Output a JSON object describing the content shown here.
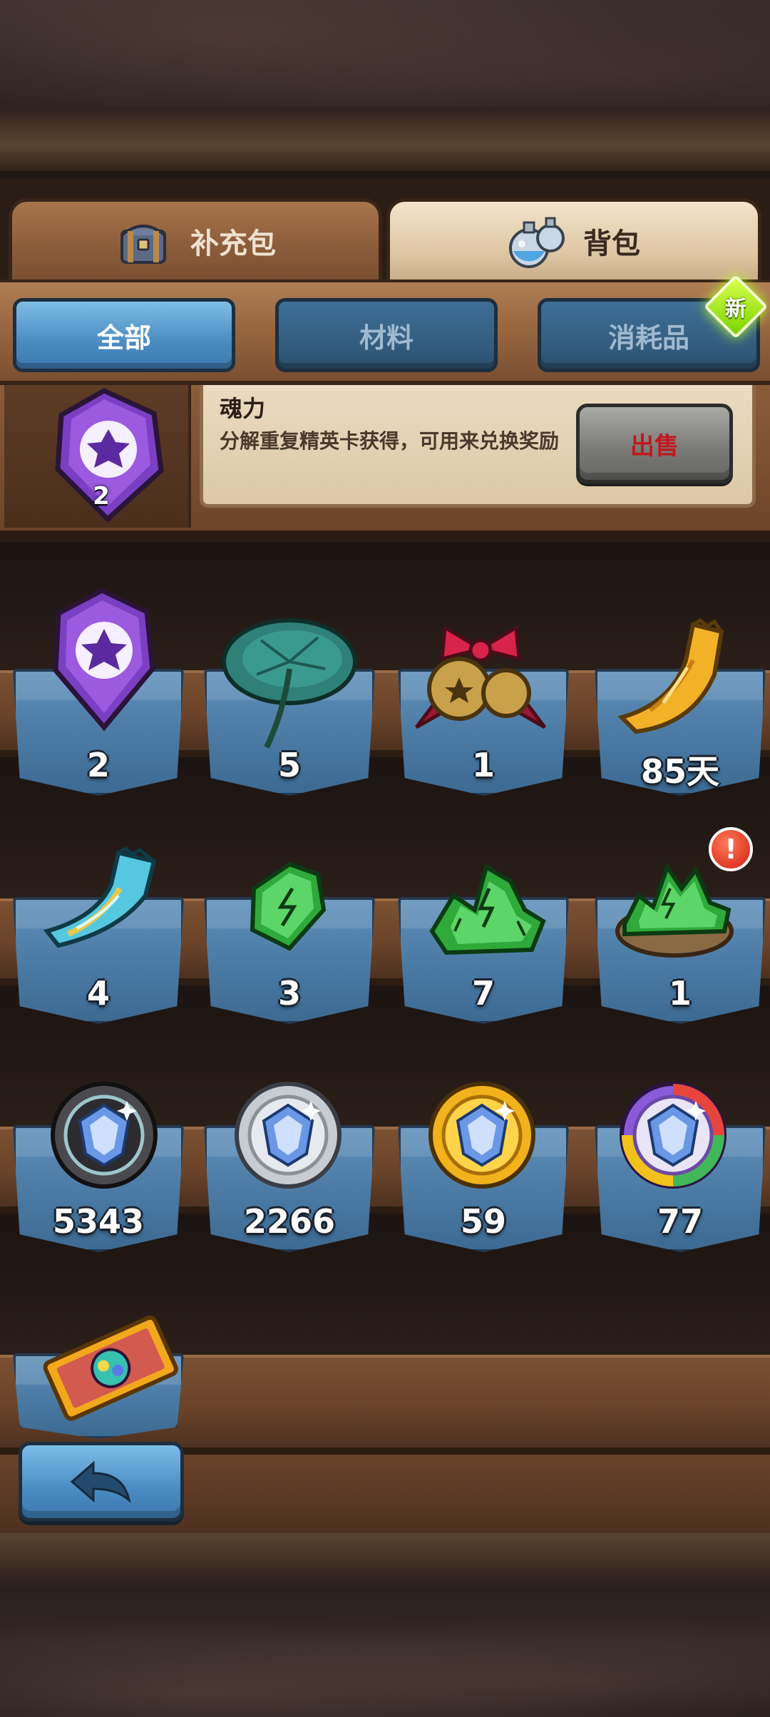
{
  "main_tabs": [
    {
      "label": "补充包",
      "active": false,
      "icon": "chest-icon"
    },
    {
      "label": "背包",
      "active": true,
      "icon": "potion-bottles-icon"
    }
  ],
  "sub_tabs": [
    {
      "label": "全部",
      "active": true
    },
    {
      "label": "材料",
      "active": false
    },
    {
      "label": "消耗品",
      "active": false,
      "badge": "新"
    }
  ],
  "detail": {
    "name": "魂力",
    "description": "分解重复精英卡获得，可用来兑换奖励",
    "count": "2",
    "icon": "purple-soul-gem-icon",
    "sell_label": "出售"
  },
  "items": [
    {
      "icon": "purple-soul-gem-icon",
      "count": "2"
    },
    {
      "icon": "lotus-leaf-icon",
      "count": "5"
    },
    {
      "icon": "golden-bells-icon",
      "count": "1"
    },
    {
      "icon": "golden-scroll-icon",
      "count": "85天"
    },
    {
      "icon": "blue-scroll-icon",
      "count": "4"
    },
    {
      "icon": "green-crystal-icon",
      "count": "3"
    },
    {
      "icon": "green-crystal-pile-icon",
      "count": "7"
    },
    {
      "icon": "crystal-sack-icon",
      "count": "1",
      "alert": "!"
    },
    {
      "icon": "black-gem-token-icon",
      "count": "5343"
    },
    {
      "icon": "silver-gem-token-icon",
      "count": "2266"
    },
    {
      "icon": "gold-gem-token-icon",
      "count": "59"
    },
    {
      "icon": "rainbow-gem-token-icon",
      "count": "77"
    },
    {
      "icon": "golden-ticket-icon",
      "count": ""
    }
  ],
  "colors": {
    "active_tab_blue": "#4a8cc2",
    "inactive_tab_blue": "#325b7d",
    "wood": "#7a5134",
    "sell_text": "#c0181e",
    "new_badge": "#7ad400"
  }
}
